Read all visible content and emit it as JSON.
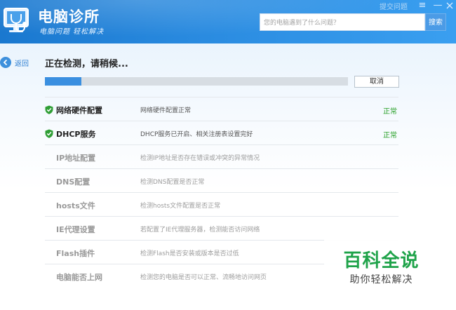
{
  "header": {
    "app_title": "电脑诊所",
    "app_subtitle": "电脑问题 轻松解决",
    "feedback_link": "提交问题",
    "menu_icon": "≡",
    "minimize_icon": "—",
    "search": {
      "placeholder": "您的电脑遇到了什么问题？",
      "button_label": "搜索"
    }
  },
  "nav": {
    "back_label": "返回"
  },
  "scan": {
    "status_title": "正在检测，请稍候...",
    "progress": 0.12,
    "cancel_label": "取消"
  },
  "items": [
    {
      "name": "网络硬件配置",
      "desc": "网络硬件配置正常",
      "status": "正常",
      "done": true
    },
    {
      "name": "DHCP服务",
      "desc": "DHCP服务已开启、相关注册表设置完好",
      "status": "正常",
      "done": true
    },
    {
      "name": "IP地址配置",
      "desc": "检测IP地址是否存在错误或冲突的异常情况",
      "status": "",
      "done": false
    },
    {
      "name": "DNS配置",
      "desc": "检测DNS配置是否正常",
      "status": "",
      "done": false
    },
    {
      "name": "hosts文件",
      "desc": "检测hosts文件配置是否正常",
      "status": "",
      "done": false
    },
    {
      "name": "IE代理设置",
      "desc": "若配置了IE代理服务器，检测能否访问网络",
      "status": "",
      "done": false
    },
    {
      "name": "Flash插件",
      "desc": "检测Flash是否安装或版本是否过低",
      "status": "",
      "done": false
    },
    {
      "name": "电脑能否上网",
      "desc": "检测您的电脑是否可以正常、流畅地访问网页",
      "status": "",
      "done": false
    }
  ],
  "watermark": {
    "main": "百科全说",
    "sub": "助你轻松解决"
  },
  "colors": {
    "header": "#2a8be0",
    "accent": "#3a8fe0",
    "ok": "#2aa12a",
    "watermark": "#1fa34a"
  },
  "icons": {
    "logo": "monitor-stethoscope-icon",
    "back": "back-arrow-icon",
    "ok": "shield-check-icon"
  }
}
